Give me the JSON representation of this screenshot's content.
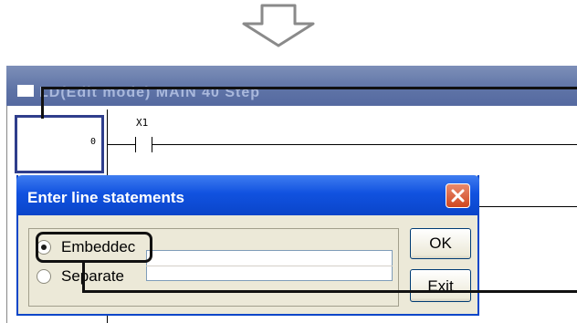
{
  "window": {
    "title": "LD(Edit mode)   MAIN   40 Step"
  },
  "ladder": {
    "step_number": "0",
    "contact_label": "X1"
  },
  "dialog": {
    "title": "Enter line statements",
    "close_label": "✕",
    "radio_embedded_label": "Embeddec",
    "radio_separate_label": "Separate",
    "embedded_selected": true,
    "text_value": "",
    "ok_label": "OK",
    "exit_label": "Exit"
  },
  "colors": {
    "dialog_title_blue": "#1152e0",
    "window_title_blue": "#5e73a6",
    "close_red": "#d0471f",
    "step_cell_border": "#2f3e8c"
  }
}
